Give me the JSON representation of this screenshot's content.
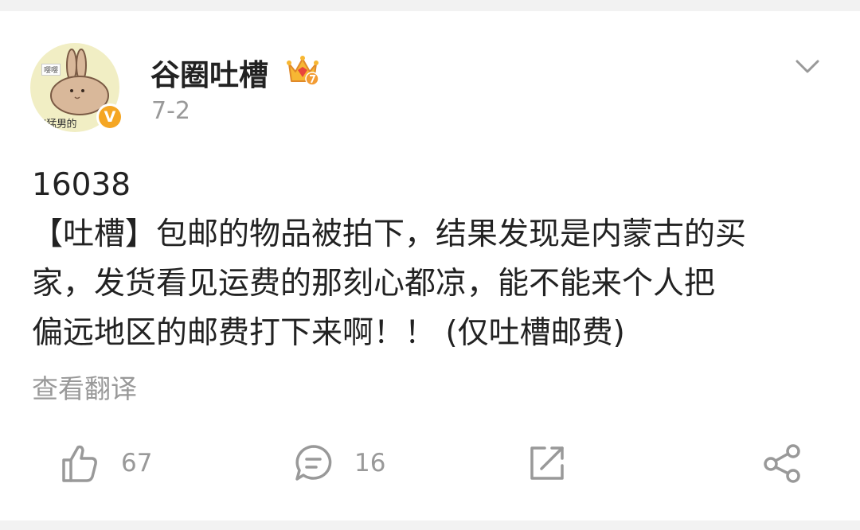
{
  "post": {
    "author": "谷圈吐槽",
    "avatar_caption": "出猛男的",
    "avatar_tag": "嘤嘤",
    "verified_icon": "v-badge",
    "verified_label": "V",
    "date": "7-2",
    "lines": [
      "16038",
      "【吐槽】包邮的物品被拍下，结果发现是内蒙古的买",
      "家，发货看见运费的那刻心都凉，能不能来个人把",
      "偏远地区的邮费打下来啊！！ (仅吐槽邮费)"
    ],
    "translate_label": "查看翻译"
  },
  "actions": {
    "like_count": "67",
    "comment_count": "16"
  },
  "colors": {
    "background": "#f2f2f2",
    "text": "#222222",
    "muted": "#999999",
    "badge": "#f5a623"
  },
  "icons": [
    "crown-icon",
    "chevron-down-icon",
    "thumbs-up-icon",
    "comment-icon",
    "repost-icon",
    "share-icon"
  ]
}
